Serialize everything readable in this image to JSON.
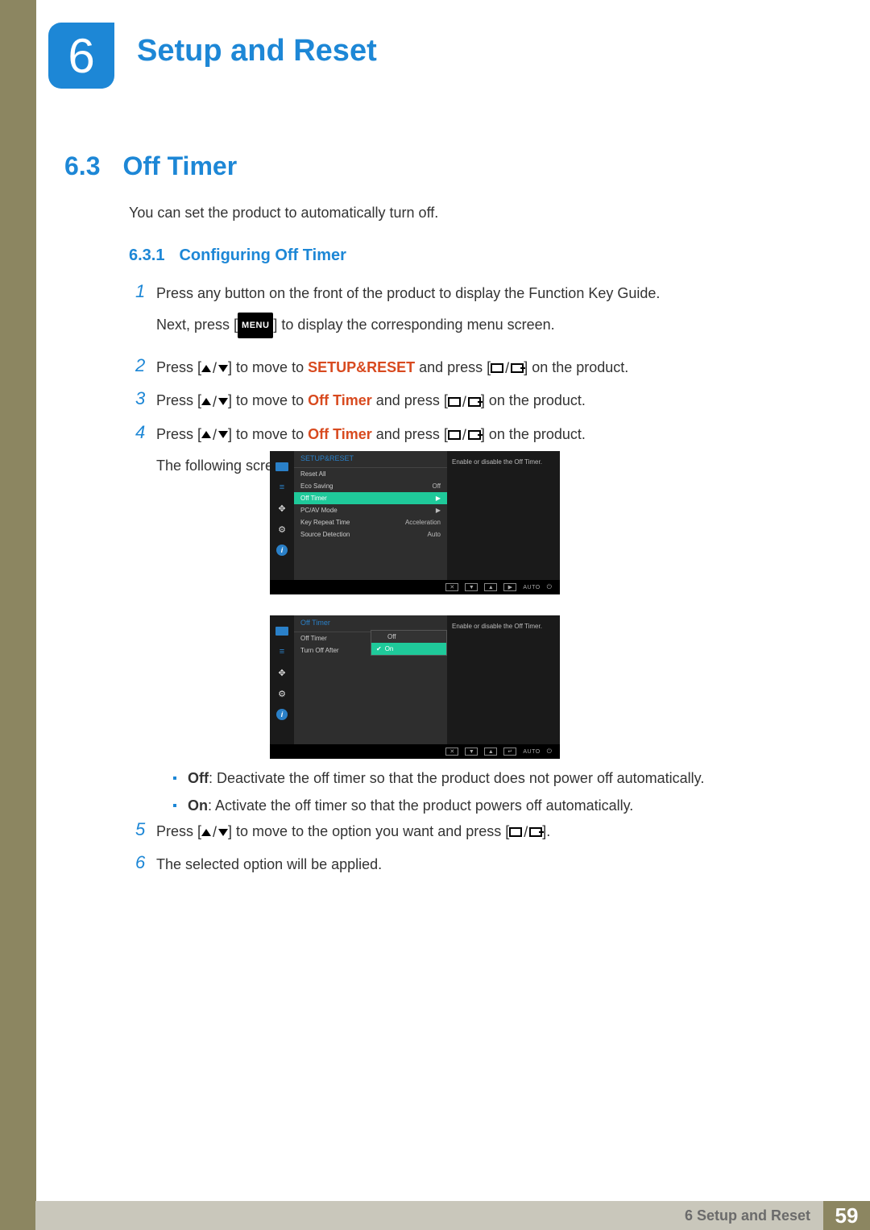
{
  "chapter": {
    "number": "6",
    "title": "Setup and Reset"
  },
  "section": {
    "number": "6.3",
    "title": "Off Timer"
  },
  "intro": "You can set the product to automatically turn off.",
  "subsection": {
    "number": "6.3.1",
    "title": "Configuring Off Timer"
  },
  "steps": {
    "s1a": "Press any button on the front of the product to display the Function Key Guide.",
    "s1b_pre": "Next, press [",
    "s1b_menu": "MENU",
    "s1b_post": "] to display the corresponding menu screen.",
    "s2_pre": "Press [",
    "s2_mid": "] to move to ",
    "s2_em": "SETUP&RESET",
    "s2_mid2": " and press [",
    "s2_post": "] on the product.",
    "s3_pre": "Press [",
    "s3_mid": "] to move to ",
    "s3_em": "Off Timer",
    "s3_mid2": " and press [",
    "s3_post": "] on the product.",
    "s4_pre": "Press [",
    "s4_mid": "] to move to ",
    "s4_em": "Off Timer",
    "s4_mid2": " and press [",
    "s4_post": "] on the product.",
    "s4_tail": "The following screen will appear.",
    "s5_pre": "Press [",
    "s5_mid": "] to move to the option you want and press [",
    "s5_post": "].",
    "s6": "The selected option will be applied."
  },
  "osd1": {
    "title": "SETUP&RESET",
    "rows": [
      {
        "label": "Reset All",
        "val": ""
      },
      {
        "label": "Eco Saving",
        "val": "Off"
      },
      {
        "label": "Off Timer",
        "val": "▶",
        "sel": true
      },
      {
        "label": "PC/AV Mode",
        "val": "▶"
      },
      {
        "label": "Key Repeat Time",
        "val": "Acceleration"
      },
      {
        "label": "Source Detection",
        "val": "Auto"
      }
    ],
    "desc": "Enable or disable the Off Timer.",
    "footer_auto": "AUTO"
  },
  "osd2": {
    "title": "Off Timer",
    "rows": [
      {
        "label": "Off Timer",
        "val": ""
      },
      {
        "label": "Turn Off After",
        "val": ""
      }
    ],
    "opts": {
      "off": "Off",
      "on": "On"
    },
    "desc": "Enable or disable the Off Timer.",
    "footer_auto": "AUTO"
  },
  "bullets": {
    "off_label": "Off",
    "off_text": ": Deactivate the off timer so that the product does not power off automatically.",
    "on_label": "On",
    "on_text": ": Activate the off timer so that the product powers off automatically."
  },
  "footer": {
    "chapter_line": "6 Setup and Reset",
    "page": "59"
  }
}
